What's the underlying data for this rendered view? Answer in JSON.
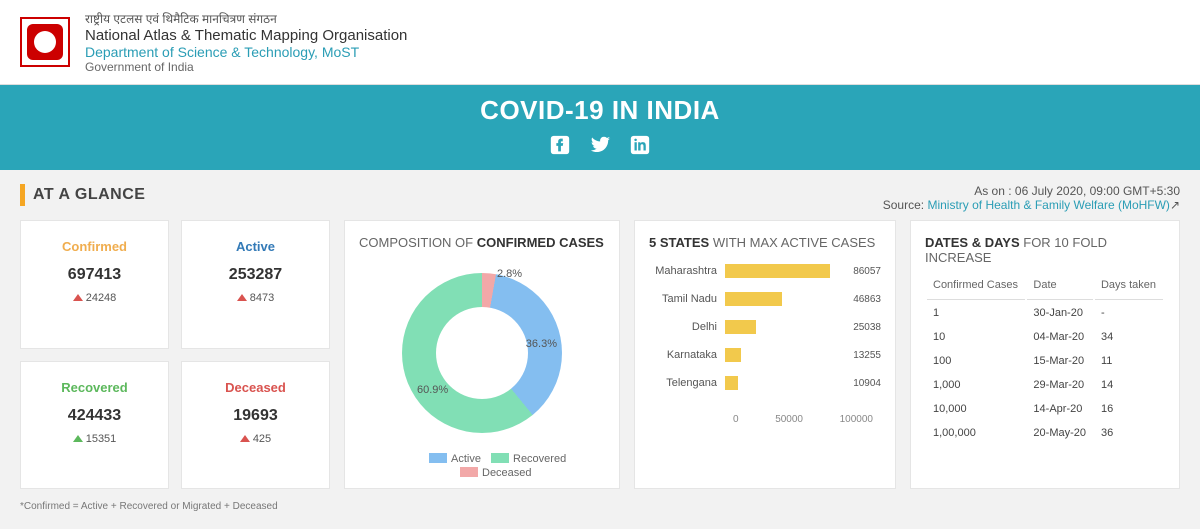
{
  "header": {
    "hindi": "राष्ट्रीय एटलस एवं थिमैटिक मानचित्रण संगठन",
    "english": "National Atlas & Thematic Mapping Organisation",
    "dept": "Department of Science & Technology, MoST",
    "govt": "Government of India"
  },
  "banner": {
    "title": "COVID-19 IN INDIA"
  },
  "glance": {
    "heading": "AT A GLANCE",
    "as_on": "As on : 06 July 2020, 09:00 GMT+5:30",
    "source_label": "Source: ",
    "source_link": "Ministry of Health & Family Welfare (MoHFW)"
  },
  "stats": {
    "confirmed": {
      "label": "Confirmed",
      "value": "697413",
      "delta": "24248"
    },
    "active": {
      "label": "Active",
      "value": "253287",
      "delta": "8473"
    },
    "recovered": {
      "label": "Recovered",
      "value": "424433",
      "delta": "15351"
    },
    "deceased": {
      "label": "Deceased",
      "value": "19693",
      "delta": "425"
    }
  },
  "chart_data": [
    {
      "type": "pie",
      "title": "COMPOSITION OF CONFIRMED CASES",
      "series": [
        {
          "name": "Active",
          "value": 36.3,
          "color": "#84bef0"
        },
        {
          "name": "Recovered",
          "value": 60.9,
          "color": "#81dfb5"
        },
        {
          "name": "Deceased",
          "value": 2.8,
          "color": "#f2a8a8"
        }
      ]
    },
    {
      "type": "bar",
      "title": "5 STATES WITH MAX ACTIVE CASES",
      "categories": [
        "Maharashtra",
        "Tamil Nadu",
        "Delhi",
        "Karnataka",
        "Telengana"
      ],
      "values": [
        86057,
        46863,
        25038,
        13255,
        10904
      ],
      "xlim": [
        0,
        100000
      ],
      "xticks": [
        0,
        50000,
        100000
      ]
    }
  ],
  "donut": {
    "title_pre": "COMPOSITION OF ",
    "title_bold": "CONFIRMED CASES",
    "legend": {
      "active": "Active",
      "recovered": "Recovered",
      "deceased": "Deceased"
    },
    "labels": {
      "active": "36.3%",
      "recovered": "60.9%",
      "deceased": "2.8%"
    }
  },
  "top5": {
    "title_pre": "5 STATES ",
    "title_rest": "WITH MAX ACTIVE CASES",
    "rows": [
      {
        "state": "Maharashtra",
        "value": "86057",
        "pct": 86
      },
      {
        "state": "Tamil Nadu",
        "value": "46863",
        "pct": 47
      },
      {
        "state": "Delhi",
        "value": "25038",
        "pct": 25
      },
      {
        "state": "Karnataka",
        "value": "13255",
        "pct": 13
      },
      {
        "state": "Telengana",
        "value": "10904",
        "pct": 11
      }
    ],
    "axis": [
      "0",
      "50000",
      "100000"
    ]
  },
  "dates": {
    "title_bold": "DATES & DAYS ",
    "title_rest": "FOR 10 FOLD INCREASE",
    "headers": {
      "c": "Confirmed Cases",
      "d": "Date",
      "t": "Days taken"
    },
    "rows": [
      {
        "c": "1",
        "d": "30-Jan-20",
        "t": "-"
      },
      {
        "c": "10",
        "d": "04-Mar-20",
        "t": "34"
      },
      {
        "c": "100",
        "d": "15-Mar-20",
        "t": "11"
      },
      {
        "c": "1,000",
        "d": "29-Mar-20",
        "t": "14"
      },
      {
        "c": "10,000",
        "d": "14-Apr-20",
        "t": "16"
      },
      {
        "c": "1,00,000",
        "d": "20-May-20",
        "t": "36"
      }
    ]
  },
  "footnote": "*Confirmed = Active + Recovered or Migrated + Deceased"
}
